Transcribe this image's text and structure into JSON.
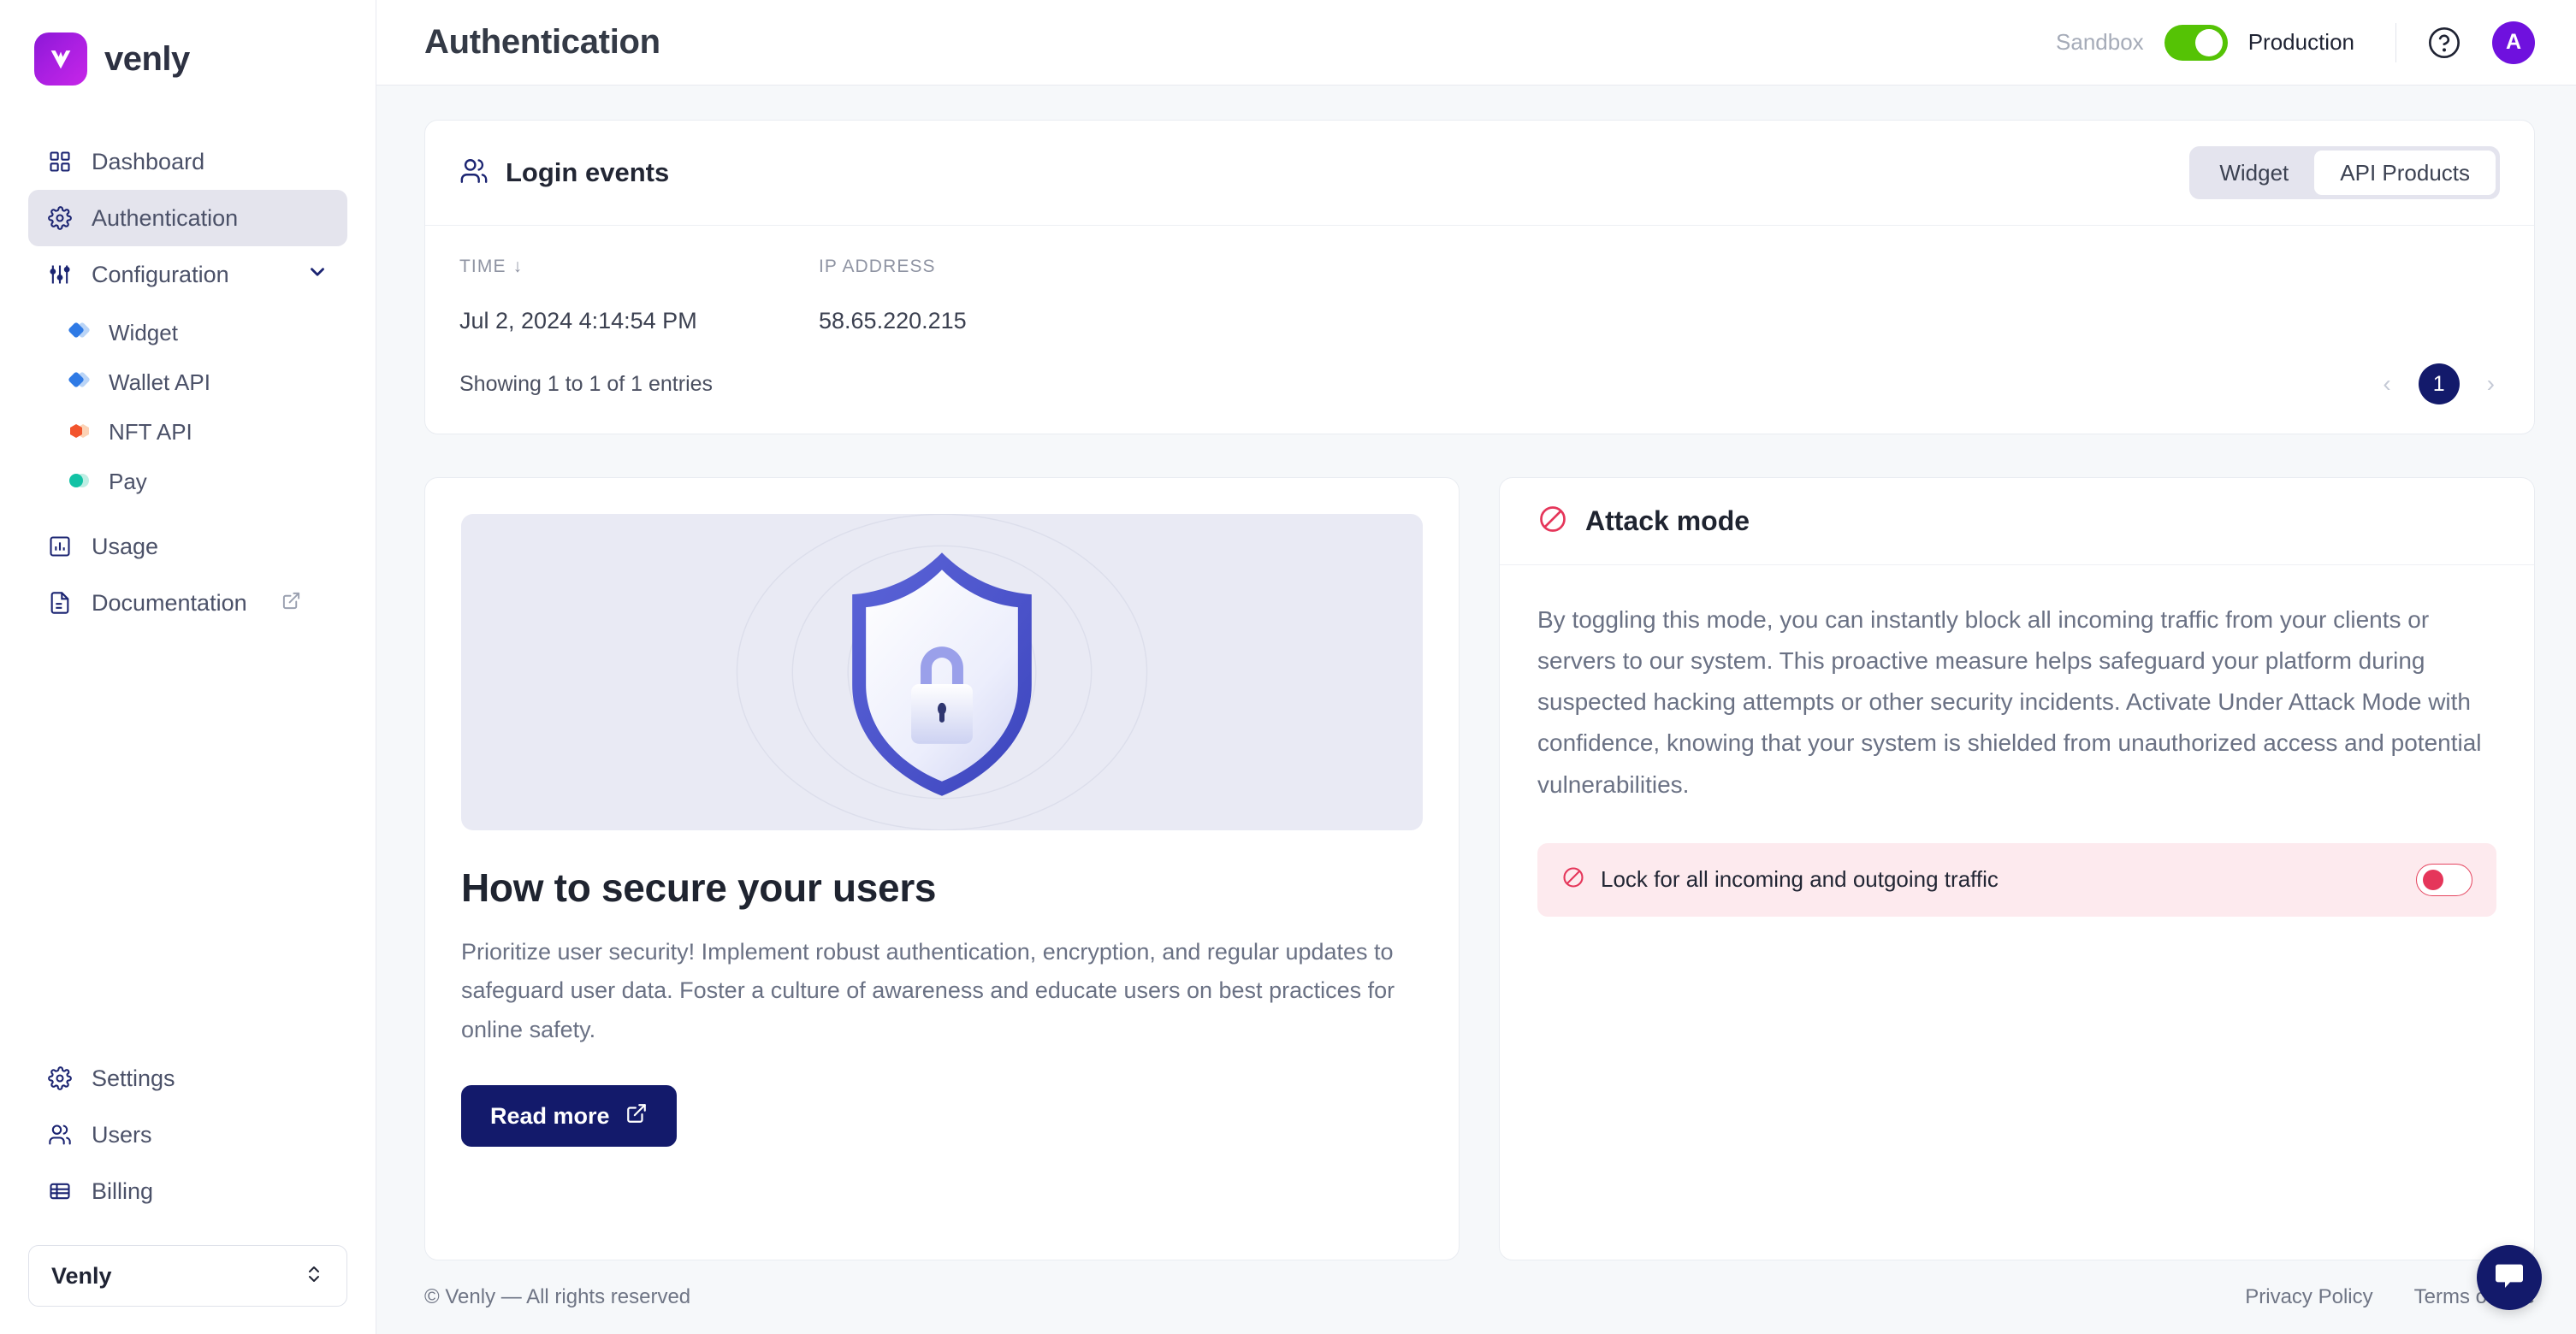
{
  "brand": {
    "name": "venly",
    "mark_icon": "venly-logo-icon"
  },
  "sidebar": {
    "items": [
      {
        "label": "Dashboard",
        "icon": "grid-icon",
        "active": false
      },
      {
        "label": "Authentication",
        "icon": "gear-icon",
        "active": true
      },
      {
        "label": "Configuration",
        "icon": "sliders-icon",
        "active": false,
        "expandable": true
      },
      {
        "label": "Usage",
        "icon": "bar-chart-icon",
        "active": false
      },
      {
        "label": "Documentation",
        "icon": "document-icon",
        "active": false,
        "external": true
      }
    ],
    "sub_items": [
      {
        "label": "Widget",
        "color": "#2f7ae5"
      },
      {
        "label": "Wallet API",
        "color": "#2f7ae5"
      },
      {
        "label": "NFT API",
        "color": "#f2542d"
      },
      {
        "label": "Pay",
        "color": "#12c2a5"
      }
    ],
    "bottom_items": [
      {
        "label": "Settings",
        "icon": "gear-icon"
      },
      {
        "label": "Users",
        "icon": "users-icon"
      },
      {
        "label": "Billing",
        "icon": "billing-icon"
      }
    ],
    "org_selector": {
      "value": "Venly",
      "icon": "chevron-updown-icon"
    }
  },
  "header": {
    "title": "Authentication",
    "env_left": "Sandbox",
    "env_right": "Production",
    "env_toggle_on": true,
    "env_toggle_color": "#55c305",
    "help_icon": "question-circle-icon",
    "avatar_initial": "A",
    "avatar_color": "#6f11de"
  },
  "login_events": {
    "title": "Login events",
    "title_icon": "users-icon",
    "segments": [
      {
        "label": "Widget",
        "active": false
      },
      {
        "label": "API Products",
        "active": true
      }
    ],
    "columns": [
      "TIME",
      "IP ADDRESS"
    ],
    "sort_indicator": "↓",
    "rows": [
      {
        "time": "Jul 2, 2024 4:14:54 PM",
        "ip": "58.65.220.215"
      }
    ],
    "entries_text": "Showing 1 to 1 of 1 entries",
    "pagination": {
      "prev": "‹",
      "page": "1",
      "next": "›"
    }
  },
  "secure_card": {
    "illustration_icon": "shield-lock-icon",
    "title": "How to secure your users",
    "body": "Prioritize user security! Implement robust authentication, encryption, and regular updates to safeguard user data. Foster a culture of awareness and educate users on best practices for online safety.",
    "button_label": "Read more",
    "button_icon": "external-link-icon",
    "button_color": "#131a6b"
  },
  "attack_mode": {
    "title": "Attack mode",
    "title_icon": "prohibition-icon",
    "body": "By toggling this mode, you can instantly block all incoming traffic from your clients or servers to our system. This proactive measure helps safeguard your platform during suspected hacking attempts or other security incidents. Activate Under Attack Mode with confidence, knowing that your system is shielded from unauthorized access and potential vulnerabilities.",
    "lock_label": "Lock for all incoming and outgoing traffic",
    "lock_icon": "prohibition-icon",
    "lock_toggle_on": false,
    "accent_color": "#e5365a"
  },
  "footer": {
    "copyright": "© Venly — All rights reserved",
    "links": [
      "Privacy Policy",
      "Terms of Use"
    ]
  },
  "chat": {
    "icon": "chat-bubble-icon",
    "color": "#131a6b"
  }
}
